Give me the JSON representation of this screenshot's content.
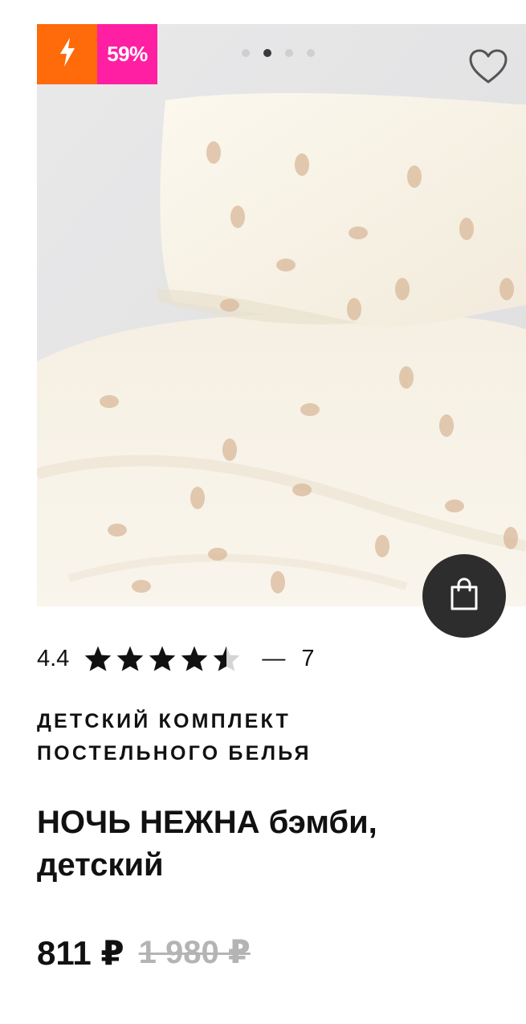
{
  "product": {
    "badge_icon": "lightning-icon",
    "discount_label": "59%",
    "gallery": {
      "total_images": 4,
      "active_index": 1
    },
    "favorite_icon": "heart-outline-icon",
    "cart_icon": "shopping-bag-icon",
    "rating": {
      "value_text": "4.4",
      "value": 4.4,
      "max": 5,
      "separator": "—",
      "reviews_count": "7"
    },
    "category": "Детский комплект постельного белья",
    "title": "НОЧЬ НЕЖНА бэмби, детский",
    "price": {
      "current": "811 ₽",
      "old": "1 980 ₽"
    }
  },
  "colors": {
    "flash_badge": "#ff6a0b",
    "discount_badge": "#ff1fa3",
    "cart_button": "#2d2d2d",
    "old_price": "#b4b4b4"
  }
}
